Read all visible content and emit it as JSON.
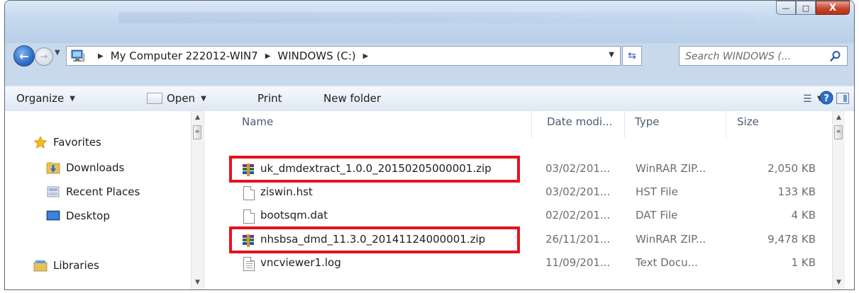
{
  "window": {
    "minimize_glyph": "—",
    "maximize_glyph": "□",
    "close_glyph": "X"
  },
  "address_bar": {
    "breadcrumbs": [
      "My Computer 222012-WIN7",
      "WINDOWS (C:)"
    ],
    "refresh_glyph": "⇆"
  },
  "search": {
    "placeholder": "Search WINDOWS (..."
  },
  "toolbar": {
    "organize_label": "Organize",
    "open_label": "Open",
    "print_label": "Print",
    "new_folder_label": "New folder"
  },
  "navigation": {
    "favorites_label": "Favorites",
    "items": [
      {
        "label": "Downloads",
        "icon": "downloads-folder-icon"
      },
      {
        "label": "Recent Places",
        "icon": "recent-places-icon"
      },
      {
        "label": "Desktop",
        "icon": "desktop-icon"
      }
    ],
    "libraries_label": "Libraries"
  },
  "file_list": {
    "columns": {
      "name": "Name",
      "date": "Date modi...",
      "type": "Type",
      "size": "Size"
    },
    "rows": [
      {
        "name": "uk_dmdextract_1.0.0_20150205000001.zip",
        "date": "03/02/201...",
        "type": "WinRAR ZIP...",
        "size": "2,050 KB",
        "icon": "winrar-archive-icon",
        "highlighted": true
      },
      {
        "name": "ziswin.hst",
        "date": "03/02/201...",
        "type": "HST File",
        "size": "133 KB",
        "icon": "file-icon",
        "highlighted": false
      },
      {
        "name": "bootsqm.dat",
        "date": "02/02/201...",
        "type": "DAT File",
        "size": "4 KB",
        "icon": "file-icon",
        "highlighted": false
      },
      {
        "name": "nhsbsa_dmd_11.3.0_20141124000001.zip",
        "date": "26/11/201...",
        "type": "WinRAR ZIP...",
        "size": "9,478 KB",
        "icon": "winrar-archive-icon",
        "highlighted": true
      },
      {
        "name": "vncviewer1.log",
        "date": "11/09/201...",
        "type": "Text Docu...",
        "size": "1 KB",
        "icon": "text-document-icon",
        "highlighted": false
      }
    ]
  },
  "colors": {
    "highlight_border": "#e8121b",
    "header_text": "#4b5b73",
    "secondary_text": "#6d6d6d"
  }
}
